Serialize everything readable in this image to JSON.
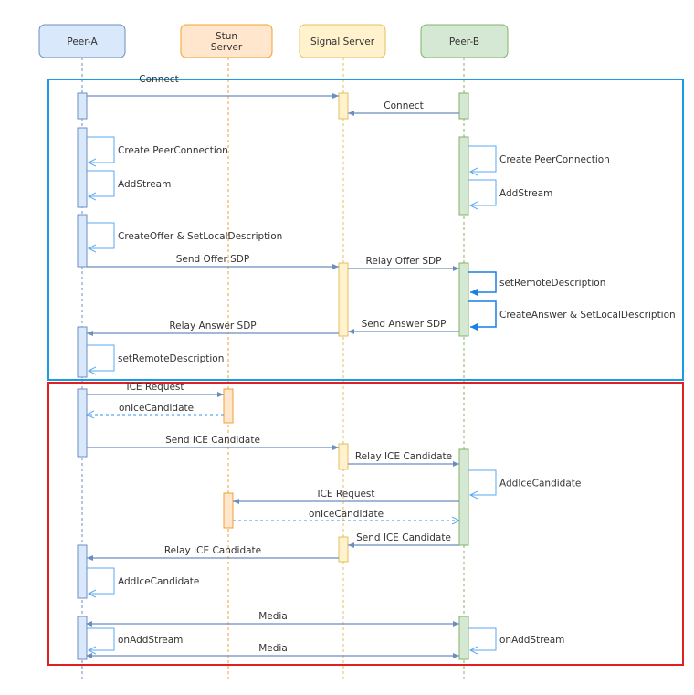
{
  "participants": [
    {
      "id": "A",
      "label": "Peer-A",
      "fill": "#dae8fc",
      "stroke": "#6c8ebf"
    },
    {
      "id": "S",
      "label": "Stun Server",
      "fill": "#ffe6cc",
      "stroke": "#f0a030"
    },
    {
      "id": "G",
      "label": "Signal Server",
      "fill": "#fff2cc",
      "stroke": "#e0c060"
    },
    {
      "id": "B",
      "label": "Peer-B",
      "fill": "#d5e8d4",
      "stroke": "#82b366"
    }
  ],
  "frames": [
    {
      "color": "#1a9be6"
    },
    {
      "color": "#e02020"
    }
  ],
  "messages": [
    {
      "from": "A",
      "to": "G",
      "label": "Connect"
    },
    {
      "from": "B",
      "to": "G",
      "label": "Connect"
    },
    {
      "from": "A",
      "to": "A",
      "label": "Create PeerConnection"
    },
    {
      "from": "A",
      "to": "A",
      "label": "AddStream"
    },
    {
      "from": "B",
      "to": "B",
      "label": "Create PeerConnection"
    },
    {
      "from": "B",
      "to": "B",
      "label": "AddStream"
    },
    {
      "from": "A",
      "to": "A",
      "label": "CreateOffer &  SetLocalDescription"
    },
    {
      "from": "A",
      "to": "G",
      "label": "Send Offer SDP"
    },
    {
      "from": "G",
      "to": "B",
      "label": "Relay Offer SDP"
    },
    {
      "from": "B",
      "to": "B",
      "label": "setRemoteDescription"
    },
    {
      "from": "B",
      "to": "B",
      "label": "CreateAnswer &  SetLocalDescription"
    },
    {
      "from": "B",
      "to": "G",
      "label": "Send Answer SDP"
    },
    {
      "from": "G",
      "to": "A",
      "label": "Relay Answer SDP"
    },
    {
      "from": "A",
      "to": "A",
      "label": "setRemoteDescription"
    },
    {
      "from": "A",
      "to": "S",
      "label": "ICE Request"
    },
    {
      "from": "S",
      "to": "A",
      "label": "onIceCandidate",
      "dashed": true
    },
    {
      "from": "A",
      "to": "G",
      "label": "Send ICE Candidate"
    },
    {
      "from": "G",
      "to": "B",
      "label": "Relay ICE Candidate"
    },
    {
      "from": "B",
      "to": "B",
      "label": "AddIceCandidate"
    },
    {
      "from": "B",
      "to": "S",
      "label": "ICE Request"
    },
    {
      "from": "S",
      "to": "B",
      "label": "onIceCandidate",
      "dashed": true
    },
    {
      "from": "B",
      "to": "G",
      "label": "Send ICE Candidate"
    },
    {
      "from": "G",
      "to": "A",
      "label": "Relay ICE Candidate"
    },
    {
      "from": "A",
      "to": "A",
      "label": "AddIceCandidate"
    },
    {
      "from": "A",
      "to": "B",
      "label": "Media",
      "both": true
    },
    {
      "from": "A",
      "to": "A",
      "label": "onAddStream"
    },
    {
      "from": "B",
      "to": "B",
      "label": "onAddStream"
    },
    {
      "from": "A",
      "to": "B",
      "label": "Media",
      "both": true
    }
  ]
}
